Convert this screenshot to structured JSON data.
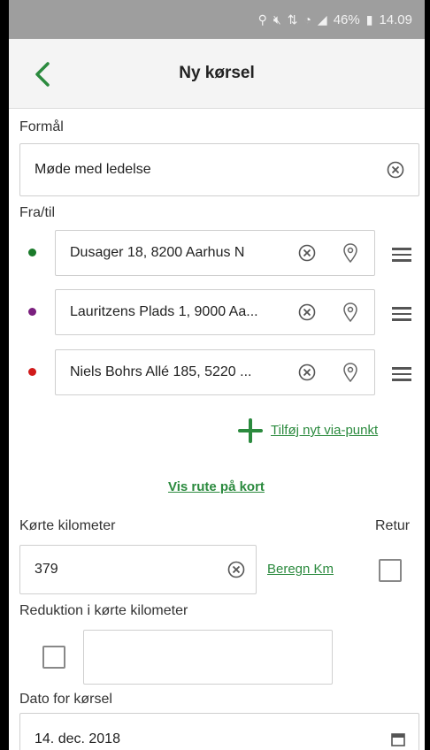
{
  "status_bar": {
    "battery": "46%",
    "time": "14.09"
  },
  "header": {
    "title": "Ny kørsel"
  },
  "form": {
    "purpose_label": "Formål",
    "purpose_value": "Møde med ledelse",
    "route_label": "Fra/til",
    "route_points": [
      {
        "address": "Dusager 18, 8200 Aarhus N",
        "color": "#1a7a2a"
      },
      {
        "address": "Lauritzens Plads 1, 9000 Aa...",
        "color": "#7a1f7e"
      },
      {
        "address": "Niels Bohrs Allé 185, 5220 ...",
        "color": "#d11a1a"
      }
    ],
    "add_via_label": "Tilføj nyt via-punkt",
    "show_route_label": "Vis rute på kort",
    "km_label": "Kørte kilometer",
    "km_value": "379",
    "calc_km_label": "Beregn Km",
    "return_label": "Retur",
    "reduction_label": "Reduktion i kørte kilometer",
    "reduction_value": "",
    "date_label": "Dato for kørsel",
    "date_value": "14. dec. 2018"
  },
  "colors": {
    "accent": "#2b8a3e",
    "status_bar": "#9e9e9e"
  }
}
